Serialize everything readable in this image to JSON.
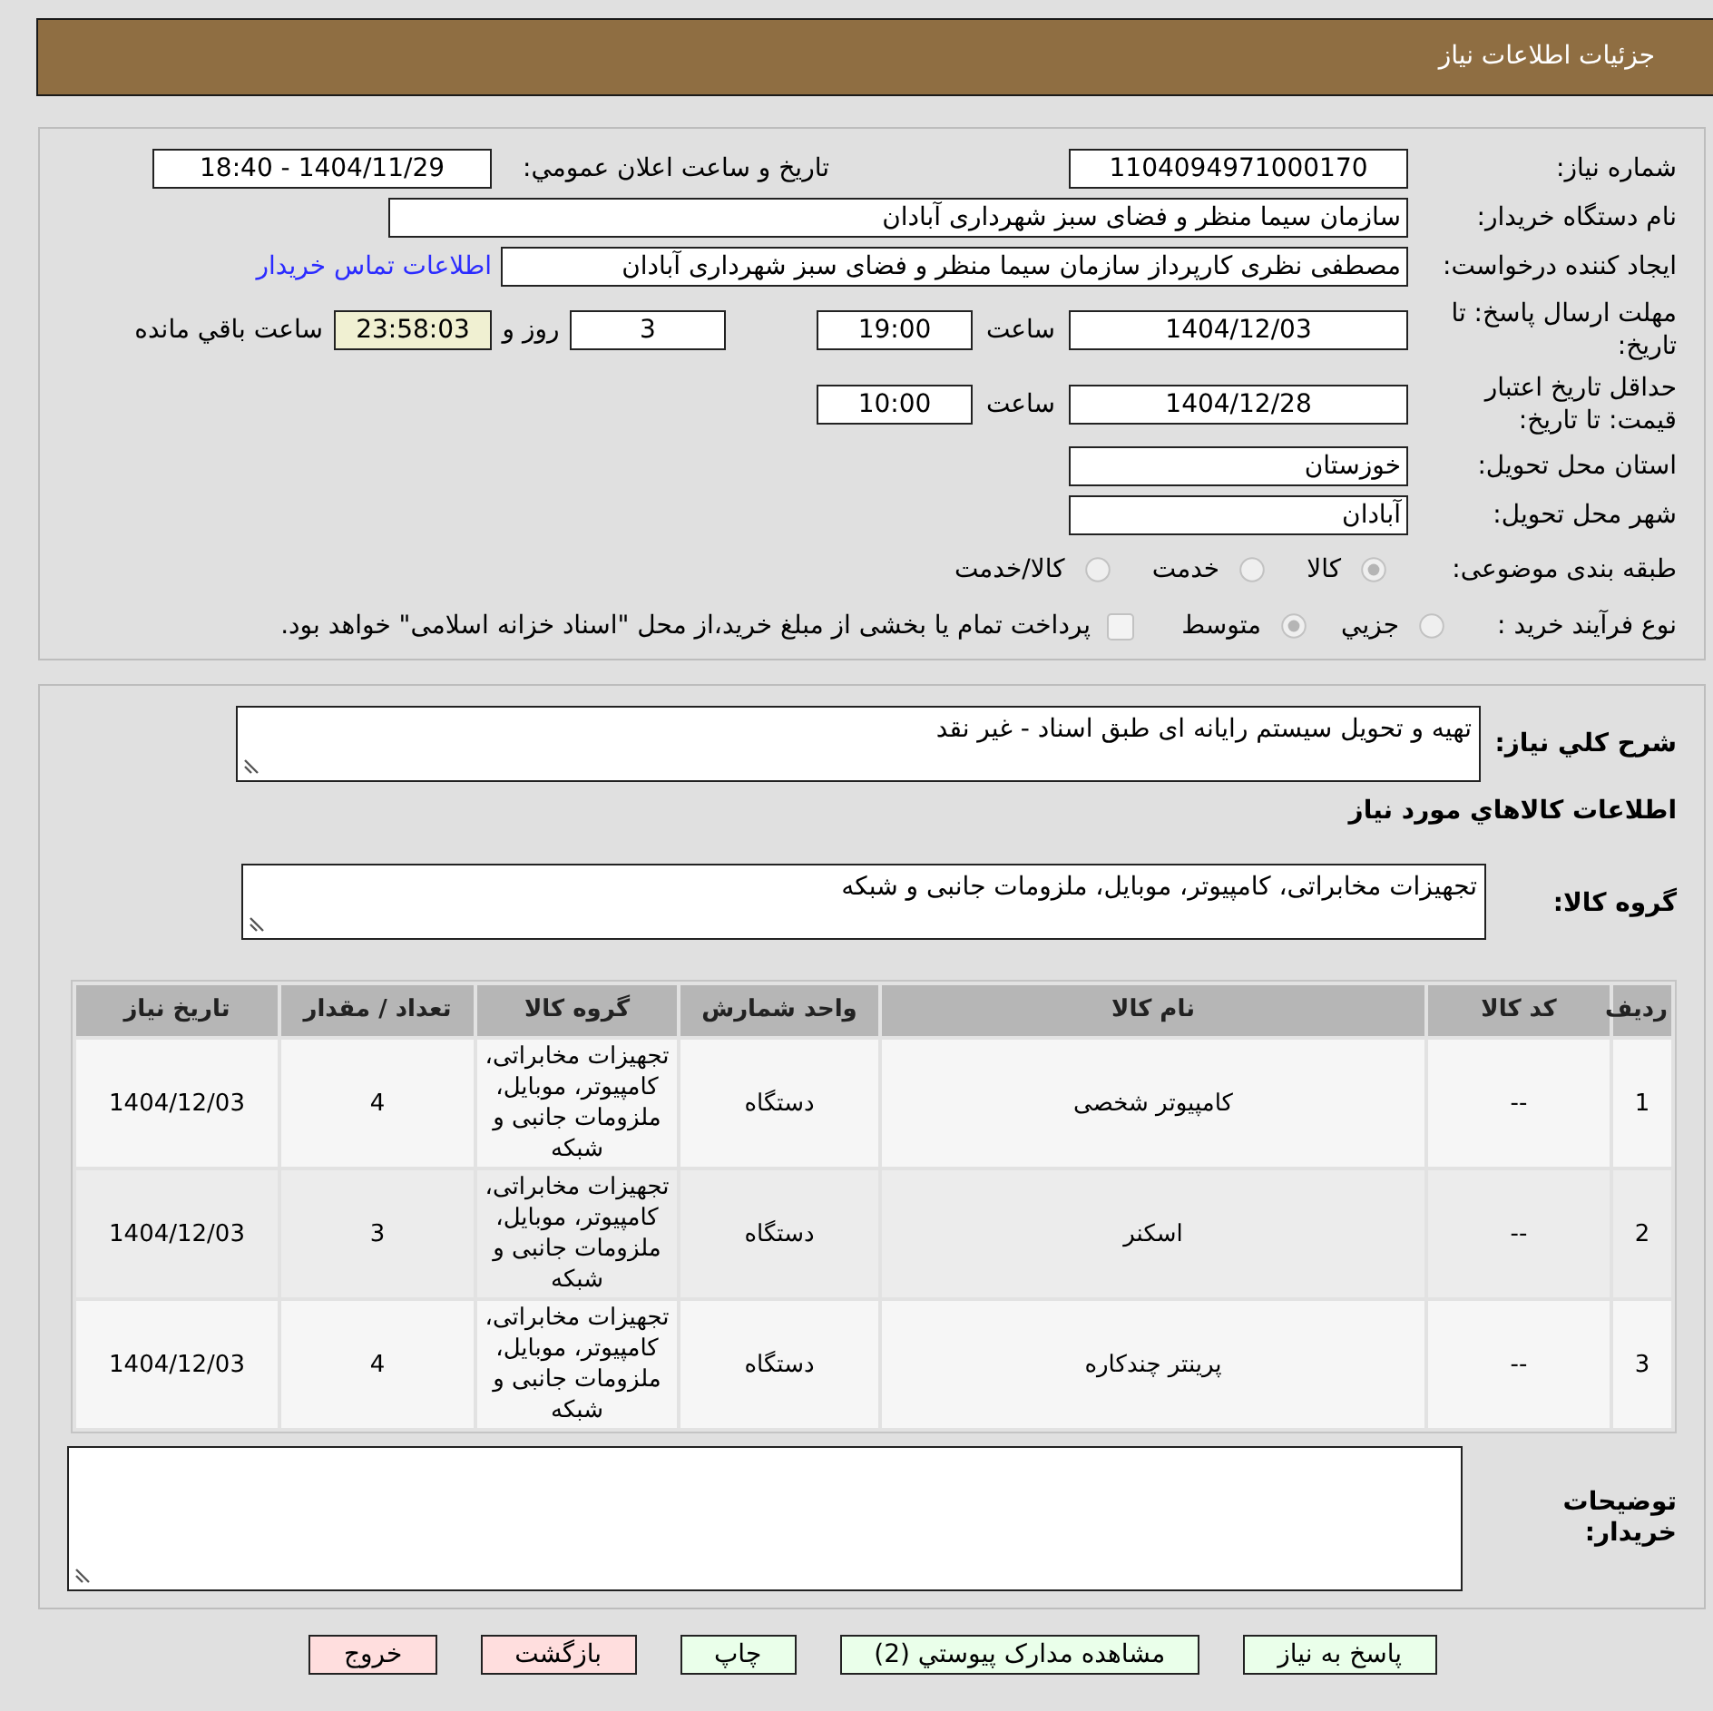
{
  "header": {
    "title": "جزئیات اطلاعات نیاز"
  },
  "details": {
    "need_number": {
      "label": "شماره نیاز:",
      "value": "1104094971000170"
    },
    "announcement": {
      "label": "تاریخ و ساعت اعلان عمومي:",
      "value": "1404/11/29 - 18:40"
    },
    "buyer_organization": {
      "label": "نام دستگاه خریدار:",
      "value": "سازمان سیما منظر و فضای سبز شهرداری آبادان"
    },
    "requester": {
      "label": "ایجاد کننده درخواست:",
      "value": "مصطفی نظری کارپرداز سازمان سیما منظر و فضای سبز شهرداری آبادان",
      "contact_link": "اطلاعات تماس خریدار"
    },
    "response_deadline": {
      "label": "مهلت ارسال پاسخ: تا تاریخ:",
      "date": "1404/12/03",
      "time_label": "ساعت",
      "time": "19:00",
      "days": "3",
      "days_label": "روز و",
      "remaining": "23:58:03",
      "remaining_label": "ساعت باقي مانده"
    },
    "price_validity": {
      "label": "حداقل تاریخ اعتبار قیمت: تا تاریخ:",
      "date": "1404/12/28",
      "time_label": "ساعت",
      "time": "10:00"
    },
    "province": {
      "label": "استان محل تحویل:",
      "value": "خوزستان"
    },
    "city": {
      "label": "شهر محل تحویل:",
      "value": "آبادان"
    },
    "category": {
      "label": "طبقه بندی موضوعی:",
      "options": [
        {
          "label": "کالا",
          "selected": true
        },
        {
          "label": "خدمت",
          "selected": false
        },
        {
          "label": "کالا/خدمت",
          "selected": false
        }
      ]
    },
    "purchase_process": {
      "label": "نوع فرآیند خرید :",
      "options": [
        {
          "label": "جزيي",
          "selected": false
        },
        {
          "label": "متوسط",
          "selected": true
        }
      ],
      "treasury_option": {
        "label": "پرداخت تمام یا بخشی از مبلغ خرید،از محل \"اسناد خزانه اسلامی\" خواهد بود.",
        "checked": false
      }
    }
  },
  "need": {
    "description_label": "شرح کلي نیاز:",
    "description": "تهیه و تحویل سیستم رایانه ای طبق اسناد - غیر نقد",
    "goods_title": "اطلاعات کالاهاي مورد نیاز",
    "goods_group_label": "گروه کالا:",
    "goods_group": "تجهیزات مخابراتی، کامپیوتر، موبایل، ملزومات جانبی و شبکه",
    "table": {
      "columns": [
        "ردیف",
        "کد کالا",
        "نام کالا",
        "واحد شمارش",
        "گروه کالا",
        "تعداد / مقدار",
        "تاریخ نیاز"
      ],
      "rows": [
        [
          "1",
          "--",
          "کامپیوتر شخصی",
          "دستگاه",
          "تجهیزات مخابراتی، کامپیوتر، موبایل، ملزومات جانبی و شبکه",
          "4",
          "1404/12/03"
        ],
        [
          "2",
          "--",
          "اسکنر",
          "دستگاه",
          "تجهیزات مخابراتی، کامپیوتر، موبایل، ملزومات جانبی و شبکه",
          "3",
          "1404/12/03"
        ],
        [
          "3",
          "--",
          "پرینتر چندکاره",
          "دستگاه",
          "تجهیزات مخابراتی، کامپیوتر، موبایل، ملزومات جانبی و شبکه",
          "4",
          "1404/12/03"
        ]
      ]
    },
    "notes_label": "توضیحات خریدار:"
  },
  "buttons": [
    {
      "label": "پاسخ به نیاز",
      "color": "#eaffea"
    },
    {
      "label": "مشاهده مدارک پیوستي (2)",
      "color": "#eaffea"
    },
    {
      "label": "چاپ",
      "color": "#eaffea"
    },
    {
      "label": "بازگشت",
      "color": "#ffdede"
    },
    {
      "label": "خروج",
      "color": "#ffdede"
    }
  ]
}
